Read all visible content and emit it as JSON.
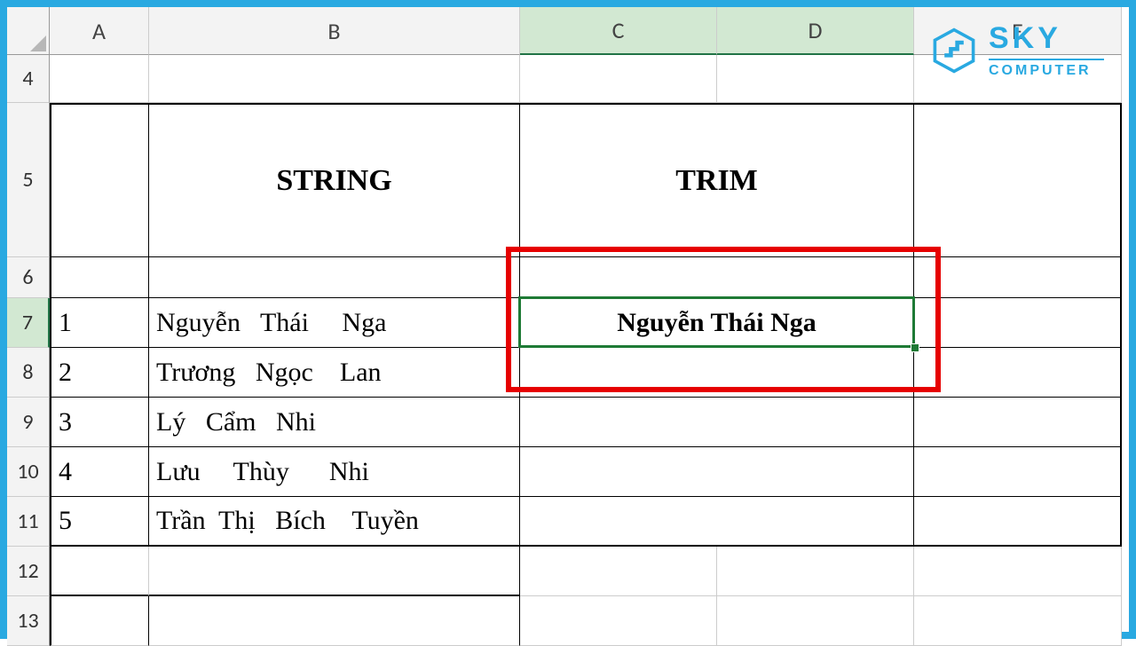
{
  "columns": [
    "A",
    "B",
    "C",
    "D",
    "E"
  ],
  "rows_visible": [
    "4",
    "5",
    "6",
    "7",
    "8",
    "9",
    "10",
    "11",
    "12",
    "13"
  ],
  "headers": {
    "string": "STRING",
    "trim": "TRIM"
  },
  "data": [
    {
      "n": "1",
      "name": "Nguyễn   Thái     Nga"
    },
    {
      "n": "2",
      "name": "Trương   Ngọc    Lan"
    },
    {
      "n": "3",
      "name": "Lý   Cẩm   Nhi"
    },
    {
      "n": "4",
      "name": "Lưu     Thùy      Nhi"
    },
    {
      "n": "5",
      "name": "Trần  Thị   Bích    Tuyền"
    }
  ],
  "trim_result": "Nguyễn Thái Nga",
  "logo": {
    "brand": "SKY",
    "sub": "COMPUTER"
  }
}
